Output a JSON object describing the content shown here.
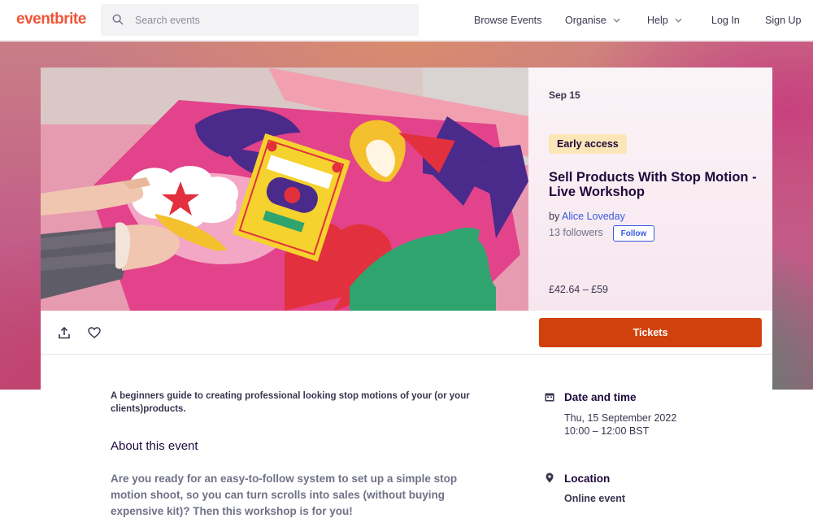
{
  "header": {
    "logo": "eventbrite",
    "search_placeholder": "Search events",
    "nav": {
      "browse": "Browse Events",
      "organise": "Organise",
      "help": "Help",
      "login": "Log In",
      "signup": "Sign Up"
    }
  },
  "event": {
    "date_short": "Sep 15",
    "badge": "Early access",
    "title": "Sell Products With Stop Motion - Live Workshop",
    "by_prefix": "by",
    "organizer": "Alice Loveday",
    "followers": "13 followers",
    "follow_label": "Follow",
    "price": "£42.64 – £59",
    "tickets_label": "Tickets",
    "summary": "A beginners guide to creating professional looking stop motions of your (or your clients)products.",
    "about_heading": "About this event",
    "about_text": "Are you ready for an easy-to-follow system to set up a simple stop motion shoot, so you can turn scrolls into sales (without buying expensive kit)? Then this workshop is for you!",
    "date_heading": "Date and time",
    "date_line1": "Thu, 15 September 2022",
    "date_line2": "10:00 – 12:00 BST",
    "location_heading": "Location",
    "location_value": "Online event"
  },
  "colors": {
    "brand": "#f05537",
    "tickets": "#d1410c",
    "link": "#3659e3",
    "badge_bg": "#fce6b8"
  },
  "icons": [
    "search-icon",
    "chevron-down-icon",
    "share-icon",
    "heart-icon",
    "calendar-icon",
    "location-pin-icon"
  ]
}
